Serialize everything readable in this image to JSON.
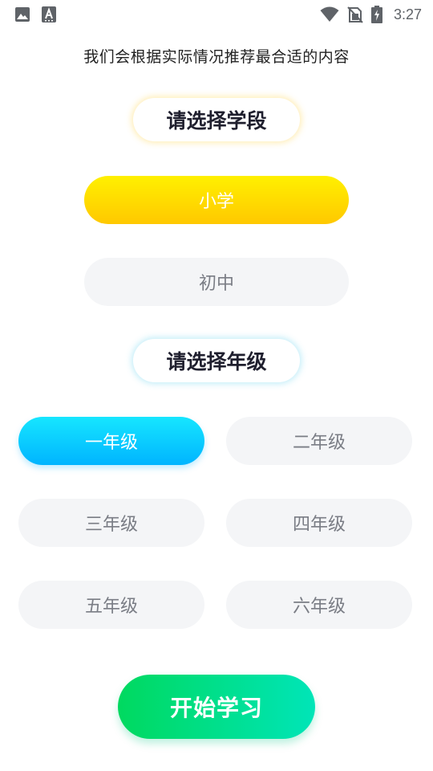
{
  "status_bar": {
    "time": "3:27",
    "left_icons": [
      "image-icon",
      "accessibility-icon"
    ],
    "right_icons": [
      "wifi-icon",
      "no-sim-icon",
      "battery-charging-icon"
    ]
  },
  "subtitle": "我们会根据实际情况推荐最合适的内容",
  "stage_section": {
    "heading": "请选择学段",
    "options": [
      {
        "label": "小学",
        "selected": true
      },
      {
        "label": "初中",
        "selected": false
      }
    ]
  },
  "grade_section": {
    "heading": "请选择年级",
    "options": [
      {
        "label": "一年级",
        "selected": true
      },
      {
        "label": "二年级",
        "selected": false
      },
      {
        "label": "三年级",
        "selected": false
      },
      {
        "label": "四年级",
        "selected": false
      },
      {
        "label": "五年级",
        "selected": false
      },
      {
        "label": "六年级",
        "selected": false
      }
    ]
  },
  "start_button_label": "开始学习",
  "colors": {
    "stage_selected": "#FFD400",
    "grade_selected": "#00C8FF",
    "start_button": "#00DD88",
    "unselected_bg": "#F4F5F7",
    "unselected_text": "#7A7D85"
  }
}
